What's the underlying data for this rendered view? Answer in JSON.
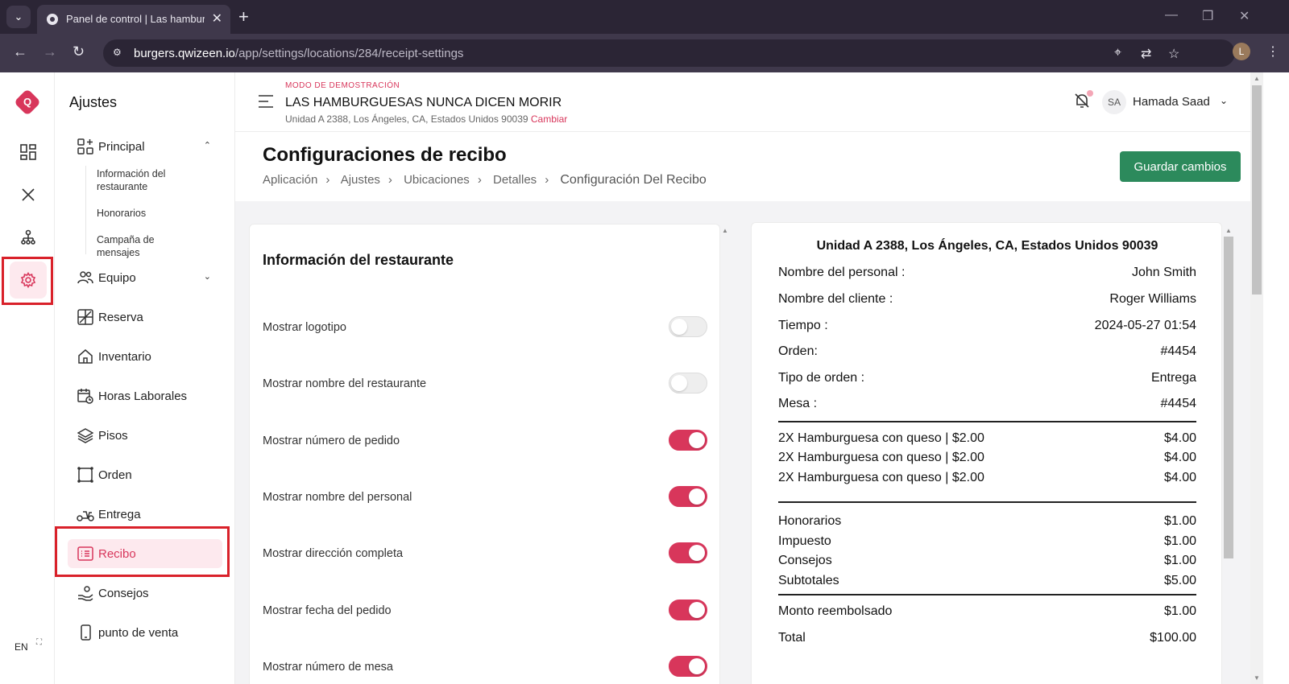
{
  "browser": {
    "tab_title": "Panel de control | Las hamburguesas",
    "url_host": "burgers.qwizeen.io",
    "url_path": "/app/settings/locations/284/receipt-settings",
    "profile_initial": "L"
  },
  "rail": {
    "logo_letter": "Q",
    "lang": "EN"
  },
  "sidebar": {
    "title": "Ajustes",
    "principal": "Principal",
    "sub_items": [
      "Información del restaurante",
      "Honorarios",
      "Campaña de mensajes"
    ],
    "items": [
      "Equipo",
      "Reserva",
      "Inventario",
      "Horas Laborales",
      "Pisos",
      "Orden",
      "Entrega",
      "Recibo",
      "Consejos",
      "punto de venta"
    ]
  },
  "topbar": {
    "demo_label": "MODO DE DEMOSTRACIÓN",
    "restaurant": "LAS HAMBURGUESAS NUNCA DICEN MORIR",
    "address": "Unidad A 2388, Los Ángeles, CA, Estados Unidos 90039",
    "change": "Cambiar",
    "avatar_initials": "SA",
    "user_name": "Hamada Saad"
  },
  "page": {
    "title": "Configuraciones de recibo",
    "breadcrumb": [
      "Aplicación",
      "Ajustes",
      "Ubicaciones",
      "Detalles",
      "Configuración Del Recibo"
    ],
    "save_label": "Guardar cambios"
  },
  "settings": {
    "section_title": "Información del restaurante",
    "options": [
      {
        "label": "Mostrar logotipo",
        "on": false
      },
      {
        "label": "Mostrar nombre del restaurante",
        "on": false
      },
      {
        "label": "Mostrar número de pedido",
        "on": true
      },
      {
        "label": "Mostrar nombre del personal",
        "on": true
      },
      {
        "label": "Mostrar dirección completa",
        "on": true
      },
      {
        "label": "Mostrar fecha del pedido",
        "on": true
      },
      {
        "label": "Mostrar número de mesa",
        "on": true
      }
    ]
  },
  "receipt": {
    "address": "Unidad A 2388, Los Ángeles, CA, Estados Unidos 90039",
    "info": [
      {
        "k": "Nombre del personal :",
        "v": "John Smith"
      },
      {
        "k": "Nombre del cliente :",
        "v": "Roger Williams"
      },
      {
        "k": "Tiempo :",
        "v": "2024-05-27 01:54"
      },
      {
        "k": "Orden:",
        "v": "#4454"
      },
      {
        "k": "Tipo de orden :",
        "v": "Entrega"
      },
      {
        "k": "Mesa :",
        "v": "#4454"
      }
    ],
    "items": [
      {
        "k": "2X Hamburguesa con queso | $2.00",
        "v": "$4.00"
      },
      {
        "k": "2X Hamburguesa con queso | $2.00",
        "v": "$4.00"
      },
      {
        "k": "2X Hamburguesa con queso | $2.00",
        "v": "$4.00"
      }
    ],
    "totals": [
      {
        "k": "Honorarios",
        "v": "$1.00"
      },
      {
        "k": "Impuesto",
        "v": "$1.00"
      },
      {
        "k": "Consejos",
        "v": "$1.00"
      },
      {
        "k": "Subtotales",
        "v": "$5.00"
      }
    ],
    "refund": {
      "k": "Monto reembolsado",
      "v": "$1.00"
    },
    "total": {
      "k": "Total",
      "v": "$100.00"
    }
  },
  "colors": {
    "accent": "#d8365b",
    "save": "#2c8a5c",
    "highlight": "#d9212a"
  }
}
